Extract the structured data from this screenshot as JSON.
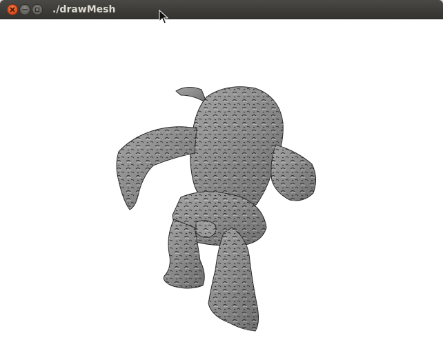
{
  "window": {
    "title": "./drawMesh"
  },
  "titlebar_buttons": {
    "close": "close-icon",
    "minimize": "minimize-icon",
    "maximize": "maximize-icon"
  },
  "colors": {
    "titlebar": "#3c3b37",
    "close_button": "#e0531f",
    "mesh_gray": "#8c8c8c",
    "canvas_background": "#ffffff"
  },
  "canvas": {
    "content": "armadillo-mesh"
  }
}
